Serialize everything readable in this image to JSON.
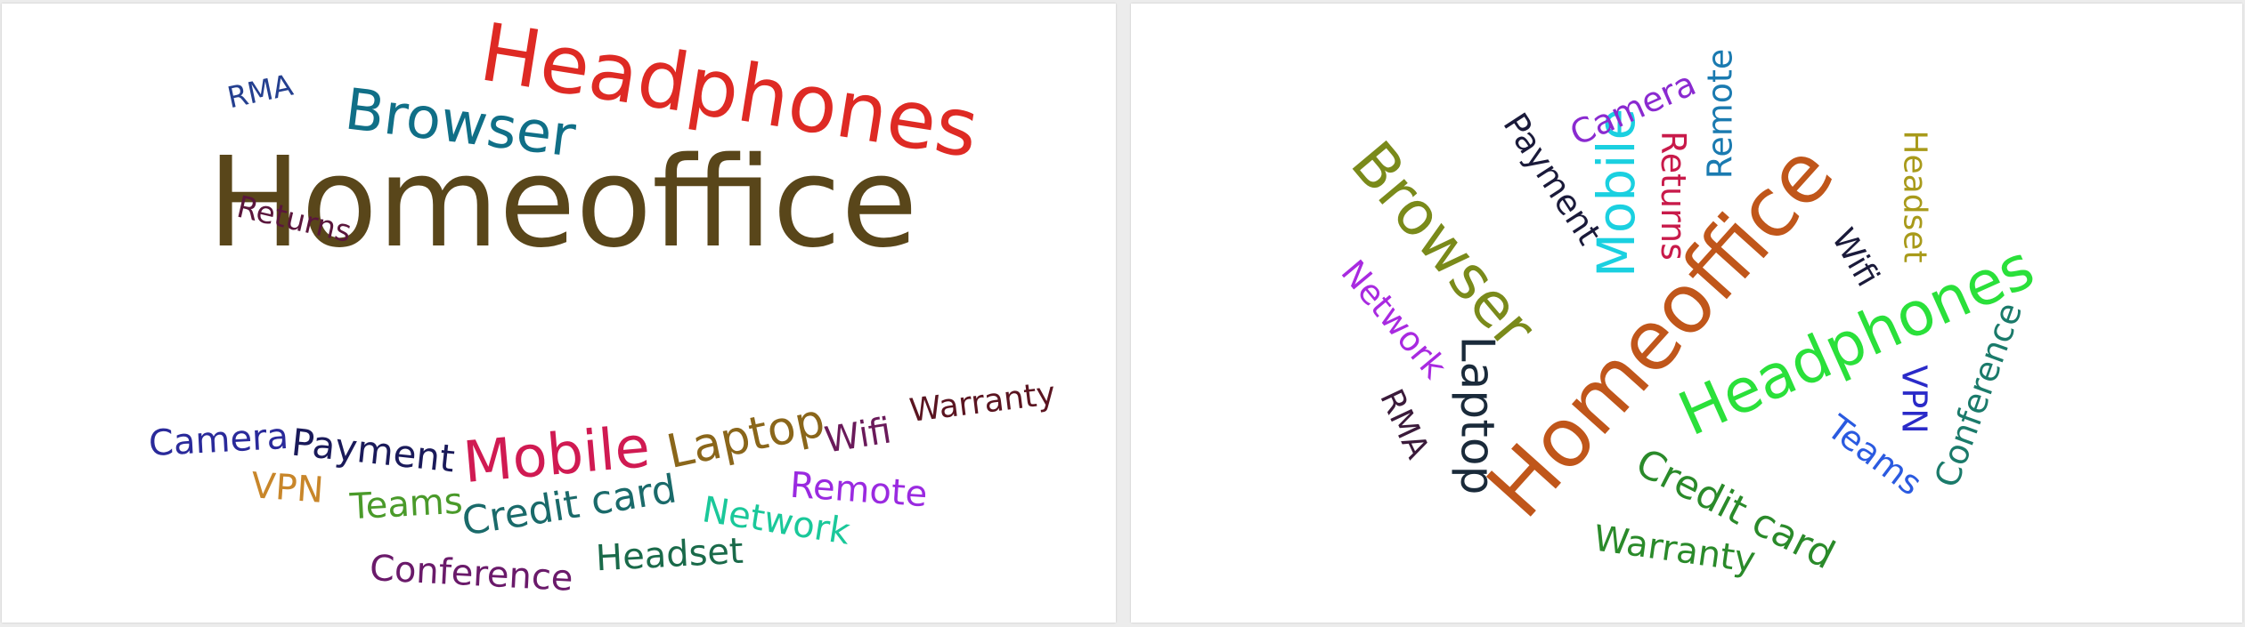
{
  "clouds": [
    {
      "name": "left",
      "words": [
        {
          "text": "Homeoffice",
          "color": "#59461a"
        },
        {
          "text": "Headphones",
          "color": "#de2a24"
        },
        {
          "text": "Browser",
          "color": "#106f87"
        },
        {
          "text": "RMA",
          "color": "#243f8f"
        },
        {
          "text": "Returns",
          "color": "#5a163c"
        },
        {
          "text": "Warranty",
          "color": "#5a1420"
        },
        {
          "text": "Camera",
          "color": "#2a2a9a"
        },
        {
          "text": "Payment",
          "color": "#1a1a5a"
        },
        {
          "text": "Mobile",
          "color": "#d01a52"
        },
        {
          "text": "Laptop",
          "color": "#8a661a"
        },
        {
          "text": "Wifi",
          "color": "#6a1a5a"
        },
        {
          "text": "VPN",
          "color": "#c8862a"
        },
        {
          "text": "Teams",
          "color": "#4a9a2a"
        },
        {
          "text": "Credit card",
          "color": "#1a6a6a"
        },
        {
          "text": "Remote",
          "color": "#9a2ae0"
        },
        {
          "text": "Network",
          "color": "#1ac89a"
        },
        {
          "text": "Conference",
          "color": "#6a1a6a"
        },
        {
          "text": "Headset",
          "color": "#1a6a4a"
        }
      ]
    },
    {
      "name": "right",
      "words": [
        {
          "text": "Homeoffice",
          "color": "#c0561a"
        },
        {
          "text": "Headphones",
          "color": "#2ae03a"
        },
        {
          "text": "Browser",
          "color": "#7a8a1a"
        },
        {
          "text": "Mobile",
          "color": "#1ad0e0"
        },
        {
          "text": "Payment",
          "color": "#1a1a3a"
        },
        {
          "text": "Camera",
          "color": "#8a2ad0"
        },
        {
          "text": "Returns",
          "color": "#c81a4a"
        },
        {
          "text": "Remote",
          "color": "#1a7ab0"
        },
        {
          "text": "Headset",
          "color": "#a89a1a"
        },
        {
          "text": "Wifi",
          "color": "#1a1a3a"
        },
        {
          "text": "Network",
          "color": "#a82ae0"
        },
        {
          "text": "RMA",
          "color": "#3a1a3a"
        },
        {
          "text": "Laptop",
          "color": "#1a2a3a"
        },
        {
          "text": "Conference",
          "color": "#1a7a6a"
        },
        {
          "text": "VPN",
          "color": "#2a2ac8"
        },
        {
          "text": "Teams",
          "color": "#2a5ae0"
        },
        {
          "text": "Credit card",
          "color": "#2a8a2a"
        },
        {
          "text": "Warranty",
          "color": "#2a8a2a"
        }
      ]
    }
  ]
}
